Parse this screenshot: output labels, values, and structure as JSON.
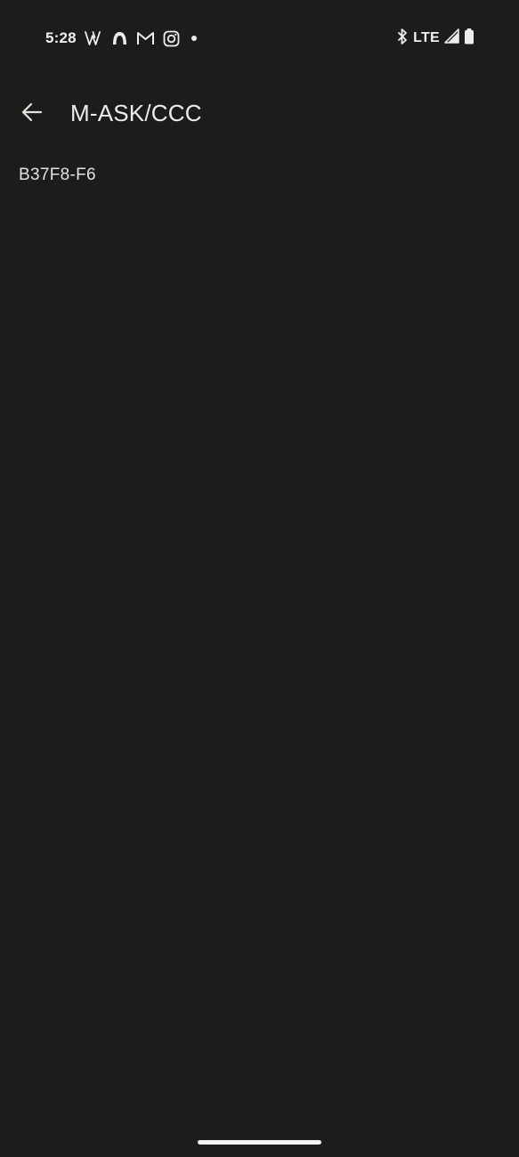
{
  "status_bar": {
    "time": "5:28",
    "left_icons": [
      "w-app-icon",
      "threads-icon",
      "gmail-icon",
      "instagram-icon",
      "notification-dot-icon"
    ],
    "network": "LTE",
    "right_icons": [
      "bluetooth-icon",
      "cellular-signal-icon",
      "battery-icon"
    ]
  },
  "app_bar": {
    "title": "M-ASK/CCC",
    "back_icon": "arrow-left-icon"
  },
  "content": {
    "code": "B37F8-F6"
  },
  "colors": {
    "background": "#1c1d1b",
    "text": "#e6e6e3"
  }
}
